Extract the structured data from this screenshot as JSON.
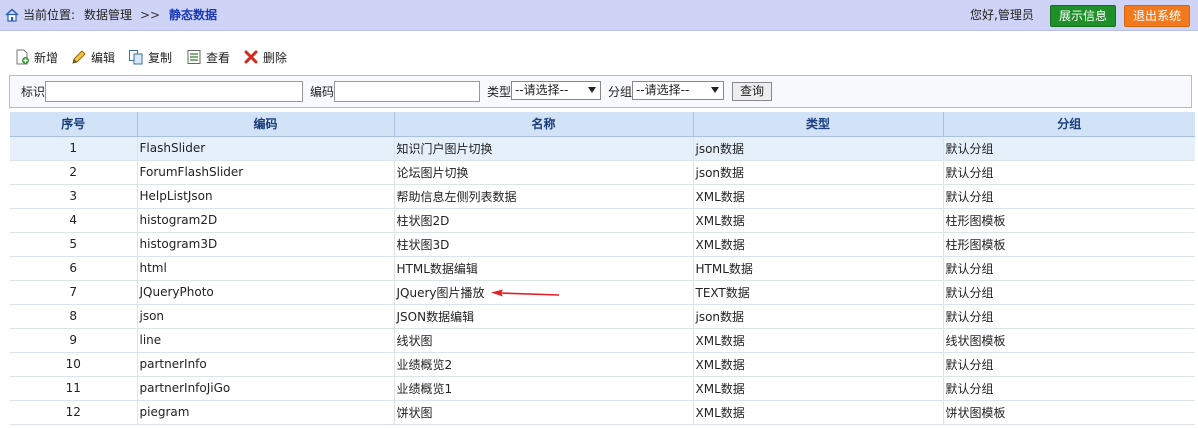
{
  "header": {
    "location_label": "当前位置:",
    "category": "数据管理",
    "separator": ">>",
    "current_page": "静态数据",
    "greeting": "您好,管理员",
    "show_info_button": "展示信息",
    "logout_button": "退出系统",
    "colors": {
      "bar": "#cfd3f5",
      "show_info": "#1f8f2a",
      "logout": "#f27a1c",
      "current_page": "#1a3ab8"
    }
  },
  "toolbar": {
    "add": "新增",
    "edit": "编辑",
    "copy": "复制",
    "view": "查看",
    "delete": "删除"
  },
  "filter": {
    "id_label": "标识",
    "id_value": "",
    "code_label": "编码",
    "code_value": "",
    "type_label": "类型",
    "type_selected": "--请选择--",
    "group_label": "分组",
    "group_selected": "--请选择--",
    "query_button": "查询"
  },
  "table": {
    "columns": [
      "序号",
      "编码",
      "名称",
      "类型",
      "分组"
    ],
    "rows": [
      [
        "1",
        "FlashSlider",
        "知识门户图片切换",
        "json数据",
        "默认分组"
      ],
      [
        "2",
        "ForumFlashSlider",
        "论坛图片切换",
        "json数据",
        "默认分组"
      ],
      [
        "3",
        "HelpListJson",
        "帮助信息左侧列表数据",
        "XML数据",
        "默认分组"
      ],
      [
        "4",
        "histogram2D",
        "柱状图2D",
        "XML数据",
        "柱形图模板"
      ],
      [
        "5",
        "histogram3D",
        "柱状图3D",
        "XML数据",
        "柱形图模板"
      ],
      [
        "6",
        "html",
        "HTML数据编辑",
        "HTML数据",
        "默认分组"
      ],
      [
        "7",
        "JQueryPhoto",
        "JQuery图片播放",
        "TEXT数据",
        "默认分组"
      ],
      [
        "8",
        "json",
        "JSON数据编辑",
        "json数据",
        "默认分组"
      ],
      [
        "9",
        "line",
        "线状图",
        "XML数据",
        "线状图模板"
      ],
      [
        "10",
        "partnerInfo",
        "业绩概览2",
        "XML数据",
        "默认分组"
      ],
      [
        "11",
        "partnerInfoJiGo",
        "业绩概览1",
        "XML数据",
        "默认分组"
      ],
      [
        "12",
        "piegram",
        "饼状图",
        "XML数据",
        "饼状图模板"
      ]
    ]
  }
}
